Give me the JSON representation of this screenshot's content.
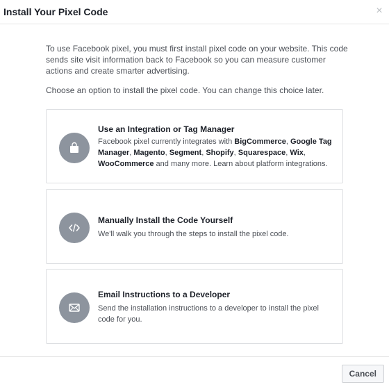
{
  "dialog": {
    "title": "Install Your Pixel Code",
    "close_glyph": "×",
    "intro": "To use Facebook pixel, you must first install pixel code on your website. This code sends site visit information back to Facebook so you can measure customer actions and create smarter advertising.",
    "choose": "Choose an option to install the pixel code. You can change this choice later."
  },
  "options": [
    {
      "title": "Use an Integration or Tag Manager",
      "icon": "shopping-bag-icon",
      "desc_prefix": "Facebook pixel currently integrates with ",
      "platforms": [
        "BigCommerce",
        "Google Tag Manager",
        "Magento",
        "Segment",
        "Shopify",
        "Squarespace",
        "Wix",
        "WooCommerce"
      ],
      "desc_suffix": " and many more. Learn about platform integrations."
    },
    {
      "title": "Manually Install the Code Yourself",
      "icon": "code-icon",
      "desc": "We'll walk you through the steps to install the pixel code."
    },
    {
      "title": "Email Instructions to a Developer",
      "icon": "envelope-icon",
      "desc": "Send the installation instructions to a developer to install the pixel code for you."
    }
  ],
  "footer": {
    "cancel_label": "Cancel"
  },
  "colors": {
    "icon_circle": "#8d949e",
    "border": "#dddfe2",
    "title_text": "#1d2129",
    "body_text": "#4b4f56"
  }
}
